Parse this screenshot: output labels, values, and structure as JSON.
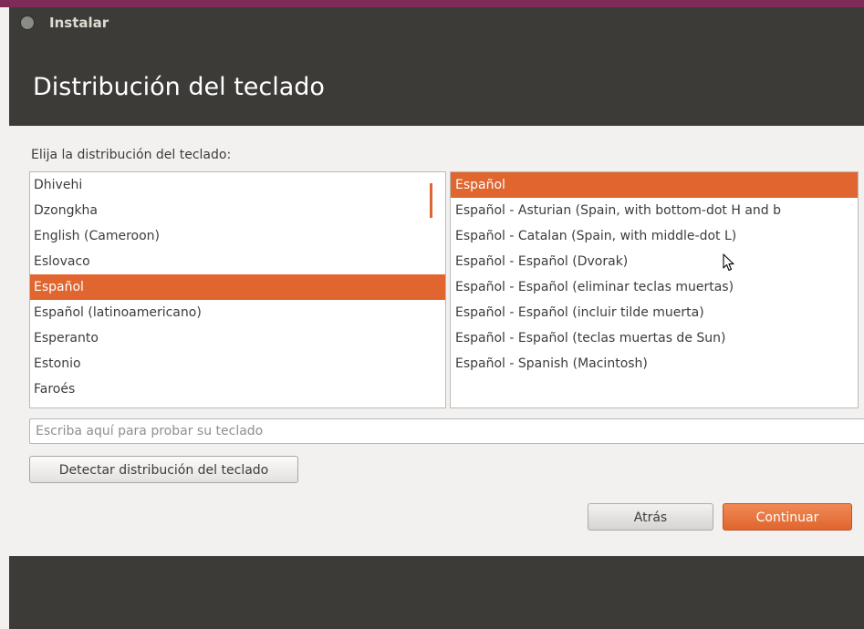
{
  "window": {
    "title": "Instalar"
  },
  "header": {
    "title": "Distribución del teclado"
  },
  "prompt": "Elija la distribución del teclado:",
  "layouts": {
    "items": [
      "Dhivehi",
      "Dzongkha",
      "English (Cameroon)",
      "Eslovaco",
      "Español",
      "Español (latinoamericano)",
      "Esperanto",
      "Estonio",
      "Faroés"
    ],
    "selected": "Español"
  },
  "variants": {
    "items": [
      "Español",
      "Español - Asturian (Spain, with bottom-dot H and b",
      "Español - Catalan (Spain, with middle-dot L)",
      "Español - Español (Dvorak)",
      "Español - Español (eliminar teclas muertas)",
      "Español - Español (incluir tilde muerta)",
      "Español - Español (teclas muertas de Sun)",
      "Español - Spanish (Macintosh)"
    ],
    "selected": "Español"
  },
  "test_input": {
    "placeholder": "Escriba aquí para probar su teclado",
    "value": ""
  },
  "buttons": {
    "detect_label": "Detectar distribución del teclado",
    "back_label": "Atrás",
    "continue_label": "Continuar"
  },
  "colors": {
    "accent": "#e0652e",
    "dark_bg": "#3c3b37",
    "window_bg": "#f2f1f0",
    "title_accent": "#7d2b57"
  }
}
